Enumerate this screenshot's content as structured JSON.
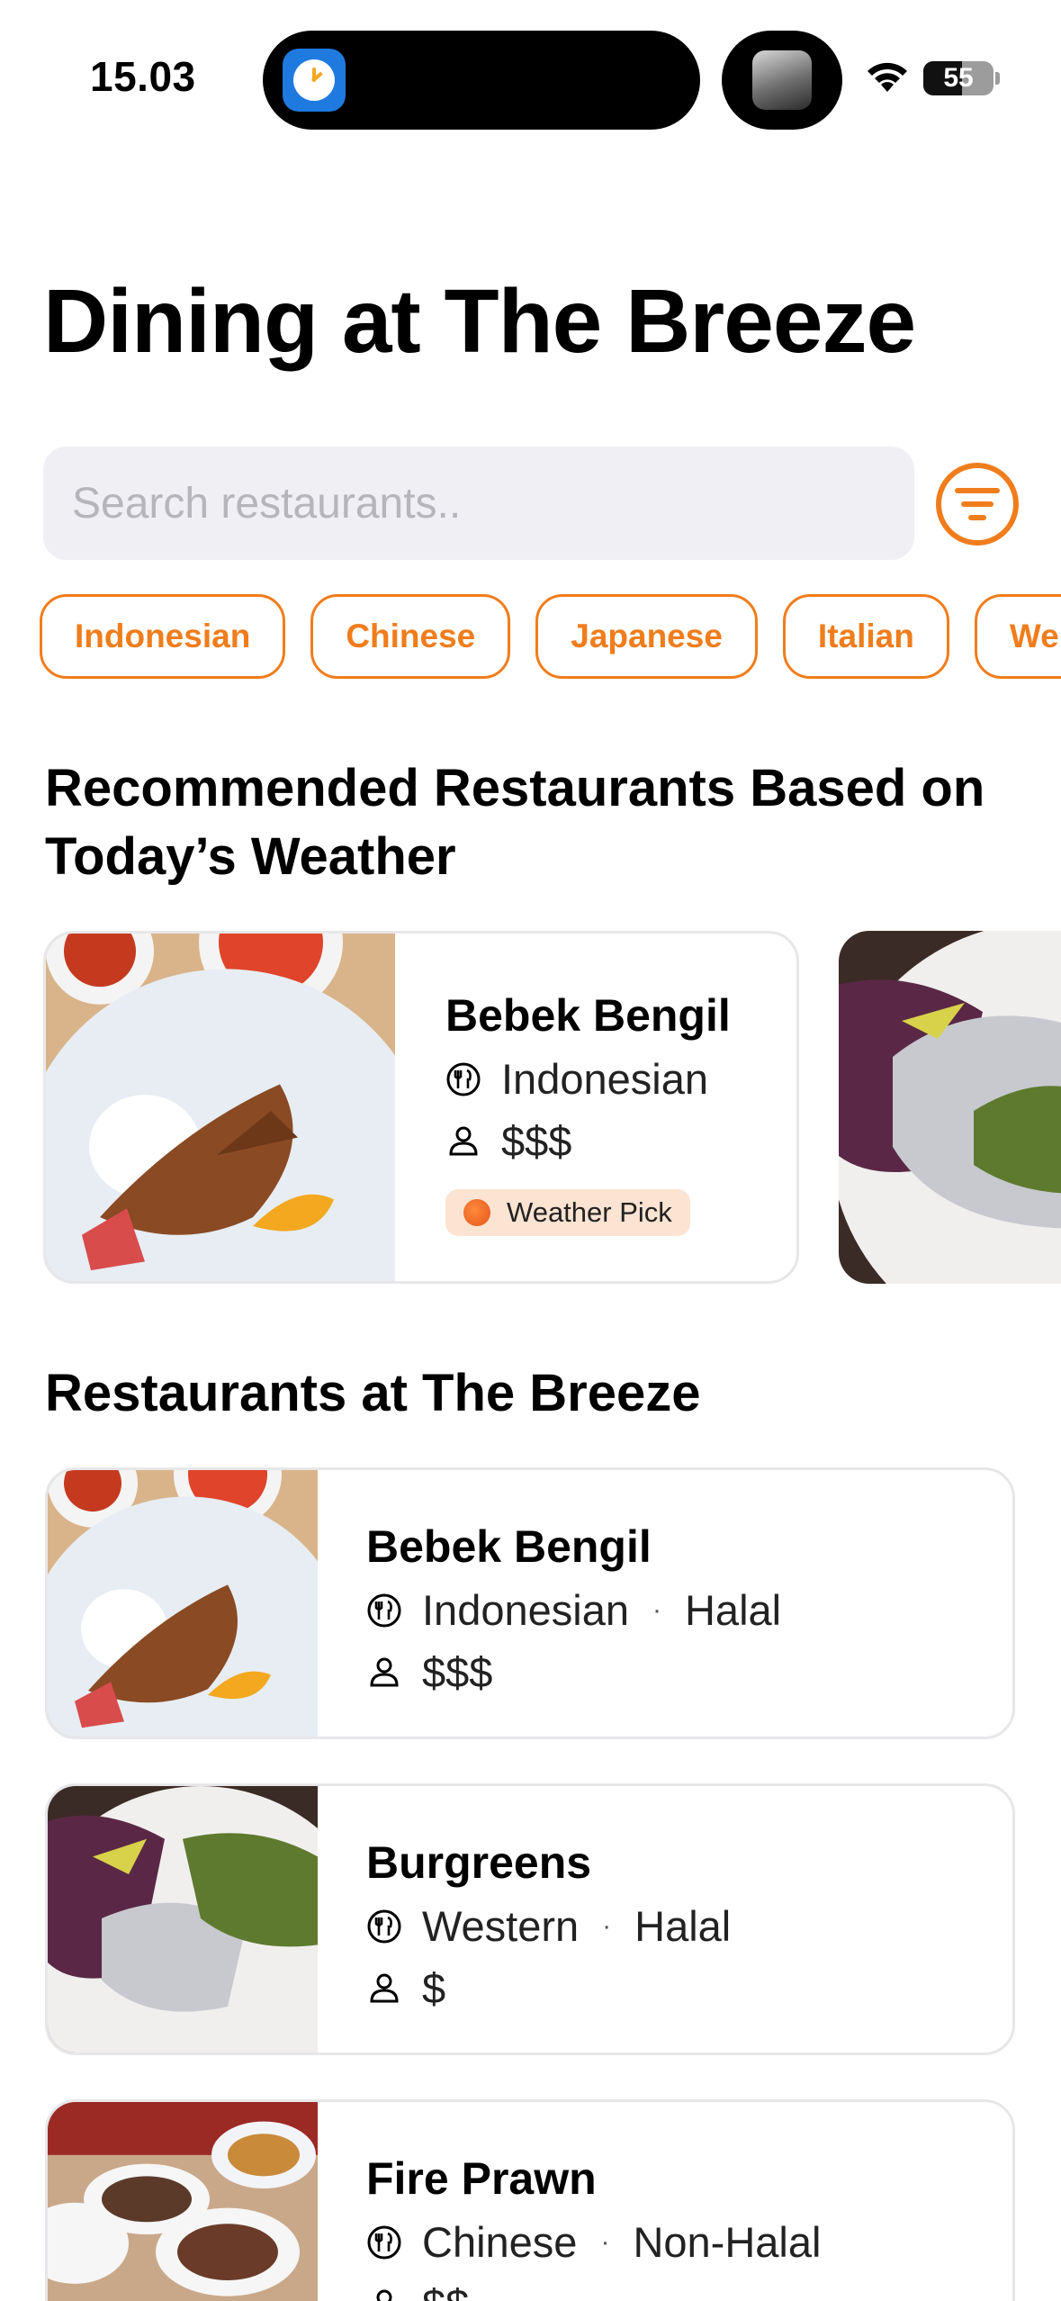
{
  "status_bar": {
    "time": "15.03",
    "battery": "55",
    "battery_level": 0.55
  },
  "page": {
    "title": "Dining at The Breeze"
  },
  "search": {
    "placeholder": "Search restaurants.."
  },
  "categories": [
    "Indonesian",
    "Chinese",
    "Japanese",
    "Italian",
    "We"
  ],
  "recommended": {
    "heading_line1": "Recommended Restaurants Based on",
    "heading_line2": "Today’s Weather",
    "card": {
      "name": "Bebek Bengil",
      "cuisine": "Indonesian",
      "price": "$$$",
      "badge": "Weather Pick"
    }
  },
  "restaurants": {
    "heading": "Restaurants at The Breeze",
    "items": [
      {
        "name": "Bebek Bengil",
        "cuisine": "Indonesian",
        "halal": "Halal",
        "price": "$$$"
      },
      {
        "name": "Burgreens",
        "cuisine": "Western",
        "halal": "Halal",
        "price": "$"
      },
      {
        "name": "Fire Prawn",
        "cuisine": "Chinese",
        "halal": "Non-Halal",
        "price": "$$"
      }
    ]
  },
  "colors": {
    "accent": "#f07d1c",
    "badge_bg": "#fce3d2",
    "search_bg": "#efeff4"
  },
  "icons": {
    "cuisine": "utensils-icon",
    "price": "person-icon",
    "filter": "filter-icon"
  }
}
